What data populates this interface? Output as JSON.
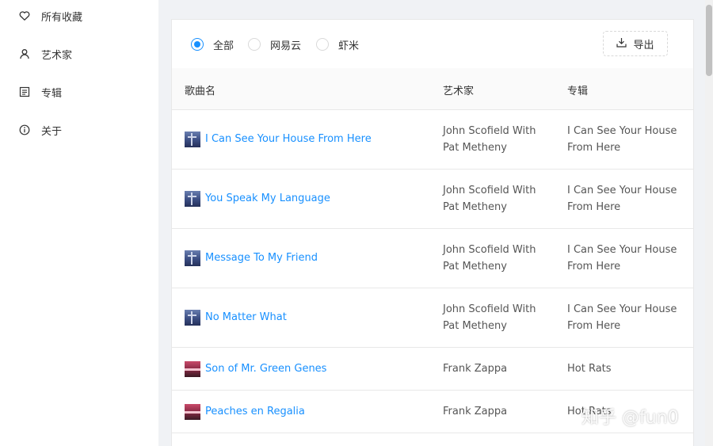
{
  "sidebar": {
    "items": [
      {
        "label": "所有收藏",
        "icon": "heart-icon"
      },
      {
        "label": "艺术家",
        "icon": "user-icon"
      },
      {
        "label": "专辑",
        "icon": "album-icon"
      },
      {
        "label": "关于",
        "icon": "info-icon"
      }
    ]
  },
  "filters": {
    "options": [
      {
        "label": "全部",
        "checked": true
      },
      {
        "label": "网易云",
        "checked": false
      },
      {
        "label": "虾米",
        "checked": false
      }
    ],
    "export_label": "导出",
    "export_icon": "download-icon"
  },
  "table": {
    "headers": [
      "歌曲名",
      "艺术家",
      "专辑"
    ],
    "rows": [
      {
        "song": "I Can See Your House From Here",
        "artist_line1": "John Scofield With",
        "artist_line2": "Pat Metheny",
        "album_line1": "I Can See Your House",
        "album_line2": "From Here",
        "cover": "blue"
      },
      {
        "song": "You Speak My Language",
        "artist_line1": "John Scofield With",
        "artist_line2": "Pat Metheny",
        "album_line1": "I Can See Your House",
        "album_line2": "From Here",
        "cover": "blue"
      },
      {
        "song": "Message To My Friend",
        "artist_line1": "John Scofield With",
        "artist_line2": "Pat Metheny",
        "album_line1": "I Can See Your House",
        "album_line2": "From Here",
        "cover": "blue"
      },
      {
        "song": "No Matter What",
        "artist_line1": "John Scofield With",
        "artist_line2": "Pat Metheny",
        "album_line1": "I Can See Your House",
        "album_line2": "From Here",
        "cover": "blue"
      },
      {
        "song": "Son of Mr. Green Genes",
        "artist_line1": "Frank Zappa",
        "artist_line2": "",
        "album_line1": "Hot Rats",
        "album_line2": "",
        "cover": "pink"
      },
      {
        "song": "Peaches en Regalia",
        "artist_line1": "Frank Zappa",
        "artist_line2": "",
        "album_line1": "Hot Rats",
        "album_line2": "",
        "cover": "pink"
      }
    ]
  },
  "watermark": "知乎 @fun0",
  "colors": {
    "accent": "#1890ff",
    "border": "#e8e8e8",
    "background": "#f0f2f5"
  }
}
